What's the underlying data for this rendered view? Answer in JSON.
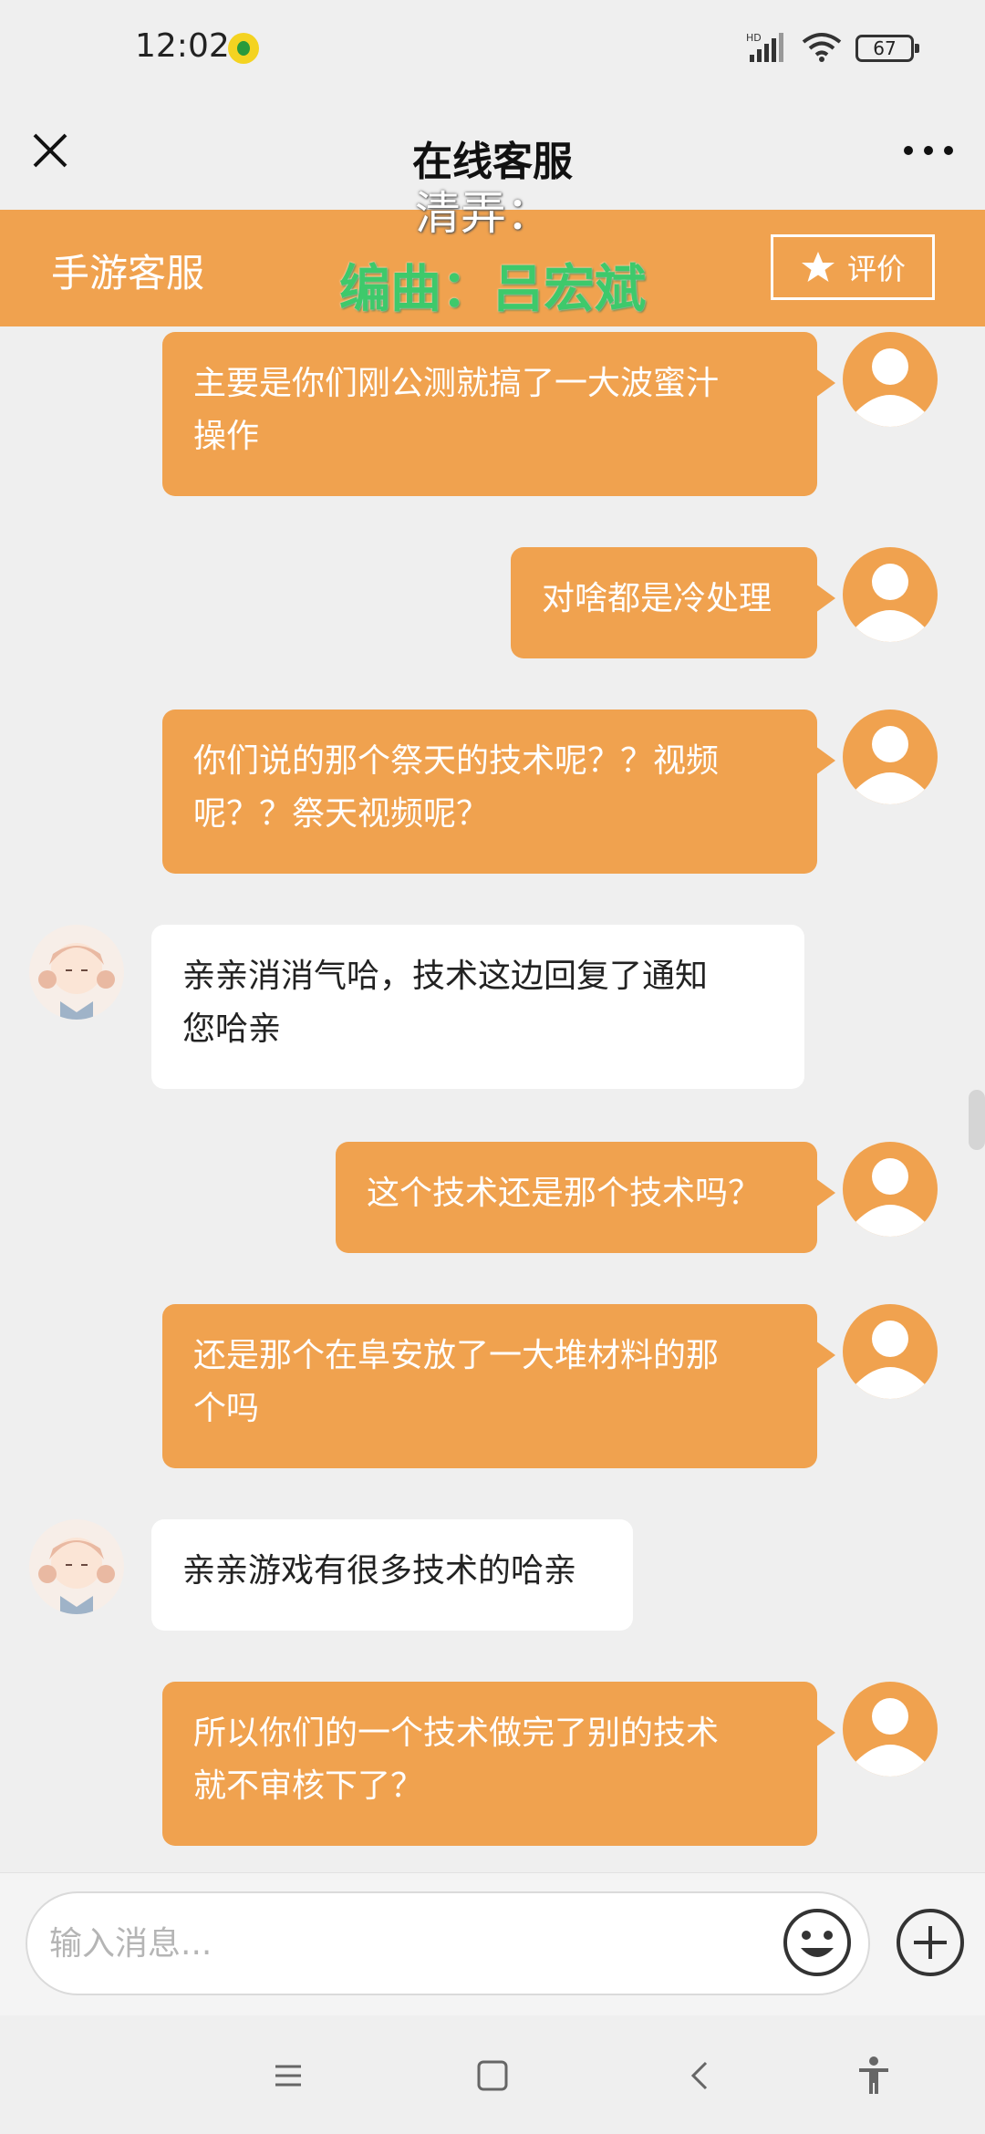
{
  "status_bar": {
    "time": "12:02",
    "network_label": "HD",
    "battery": "67"
  },
  "title_bar": {
    "title": "在线客服",
    "close_icon": "close-icon",
    "more_icon": "more-icon"
  },
  "service_header": {
    "name": "手游客服",
    "rate_label": "评价",
    "rate_icon": "star-icon",
    "accent_color": "#f0a24f"
  },
  "captions": {
    "line1": "清弄：",
    "line2": "编曲：吕宏斌"
  },
  "messages": [
    {
      "sender": "user",
      "lines": [
        "主要是你们刚公测就搞了一大波蜜汁",
        "操作"
      ]
    },
    {
      "sender": "user",
      "lines": [
        "对啥都是冷处理"
      ]
    },
    {
      "sender": "user",
      "lines": [
        "你们说的那个祭天的技术呢？？视频",
        "呢？？祭天视频呢？"
      ]
    },
    {
      "sender": "agent",
      "lines": [
        "亲亲消消气哈，技术这边回复了通知",
        "您哈亲"
      ]
    },
    {
      "sender": "user",
      "lines": [
        "这个技术还是那个技术吗？"
      ]
    },
    {
      "sender": "user",
      "lines": [
        "还是那个在阜安放了一大堆材料的那",
        "个吗"
      ]
    },
    {
      "sender": "agent",
      "lines": [
        "亲亲游戏有很多技术的哈亲"
      ]
    },
    {
      "sender": "user",
      "lines": [
        "所以你们的一个技术做完了别的技术",
        "就不审核下了？"
      ]
    }
  ],
  "input_bar": {
    "placeholder": "输入消息...",
    "emoji_icon": "emoji-icon",
    "plus_icon": "plus-icon"
  },
  "nav_bar": {
    "icons": [
      "menu-icon",
      "home-icon",
      "back-icon",
      "accessibility-icon"
    ]
  }
}
